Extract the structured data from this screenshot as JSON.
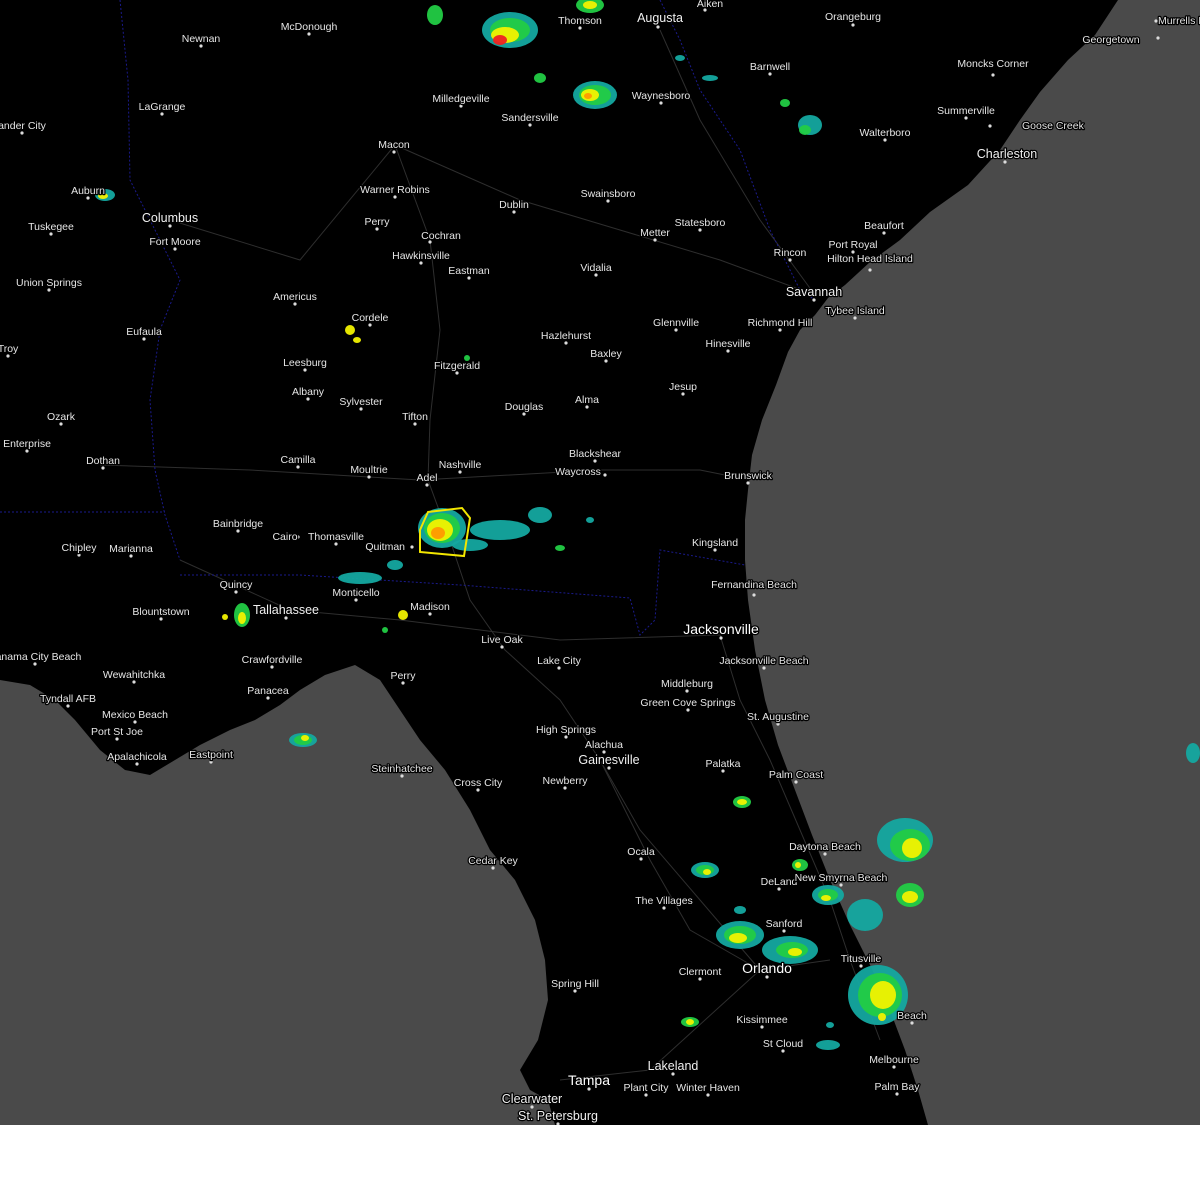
{
  "map": {
    "colors": {
      "land": "#000000",
      "water": "#4a4a4a",
      "state_border": "#1a1a8c",
      "roads": "#3a3a3a",
      "warning_polygon": "#f2e600",
      "radar_light": "#14a8a0",
      "radar_green": "#22cc44",
      "radar_yellow": "#f2f200",
      "radar_orange": "#ff9900",
      "radar_red": "#ee2222"
    },
    "cities": [
      {
        "name": "Murrells Inlet",
        "size": "small"
      },
      {
        "name": "Georgetown",
        "size": "small"
      },
      {
        "name": "Moncks Corner",
        "size": "small"
      },
      {
        "name": "Summerville",
        "size": "small"
      },
      {
        "name": "Goose Creek",
        "size": "small"
      },
      {
        "name": "Charleston",
        "size": "medium"
      },
      {
        "name": "Walterboro",
        "size": "small"
      },
      {
        "name": "Orangeburg",
        "size": "small"
      },
      {
        "name": "Aiken",
        "size": "small"
      },
      {
        "name": "Augusta",
        "size": "medium"
      },
      {
        "name": "Thomson",
        "size": "small"
      },
      {
        "name": "Barnwell",
        "size": "small"
      },
      {
        "name": "Waynesboro",
        "size": "small"
      },
      {
        "name": "McDonough",
        "size": "small"
      },
      {
        "name": "Newnan",
        "size": "small"
      },
      {
        "name": "LaGrange",
        "size": "small"
      },
      {
        "name": "Milledgeville",
        "size": "small"
      },
      {
        "name": "Sandersville",
        "size": "small"
      },
      {
        "name": "Macon",
        "size": "small"
      },
      {
        "name": "Warner Robins",
        "size": "small"
      },
      {
        "name": "Dublin",
        "size": "small"
      },
      {
        "name": "Swainsboro",
        "size": "small"
      },
      {
        "name": "Perry",
        "size": "small"
      },
      {
        "name": "Cochran",
        "size": "small"
      },
      {
        "name": "Hawkinsville",
        "size": "small"
      },
      {
        "name": "Eastman",
        "size": "small"
      },
      {
        "name": "Metter",
        "size": "small"
      },
      {
        "name": "Statesboro",
        "size": "small"
      },
      {
        "name": "Vidalia",
        "size": "small"
      },
      {
        "name": "Rincon",
        "size": "small"
      },
      {
        "name": "Beaufort",
        "size": "small"
      },
      {
        "name": "Port Royal",
        "size": "small"
      },
      {
        "name": "Hilton Head Island",
        "size": "small"
      },
      {
        "name": "Savannah",
        "size": "medium"
      },
      {
        "name": "Tybee Island",
        "size": "small"
      },
      {
        "name": "Richmond Hill",
        "size": "small"
      },
      {
        "name": "Glennville",
        "size": "small"
      },
      {
        "name": "Hinesville",
        "size": "small"
      },
      {
        "name": "Hazlehurst",
        "size": "small"
      },
      {
        "name": "Baxley",
        "size": "small"
      },
      {
        "name": "Jesup",
        "size": "small"
      },
      {
        "name": "Alma",
        "size": "small"
      },
      {
        "name": "Douglas",
        "size": "small"
      },
      {
        "name": "Fitzgerald",
        "size": "small"
      },
      {
        "name": "Cordele",
        "size": "small"
      },
      {
        "name": "Americus",
        "size": "small"
      },
      {
        "name": "Leesburg",
        "size": "small"
      },
      {
        "name": "Albany",
        "size": "small"
      },
      {
        "name": "Sylvester",
        "size": "small"
      },
      {
        "name": "Tifton",
        "size": "small"
      },
      {
        "name": "Blackshear",
        "size": "small"
      },
      {
        "name": "Waycross",
        "size": "small"
      },
      {
        "name": "Nashville",
        "size": "small"
      },
      {
        "name": "Adel",
        "size": "small"
      },
      {
        "name": "Moultrie",
        "size": "small"
      },
      {
        "name": "Camilla",
        "size": "small"
      },
      {
        "name": "Brunswick",
        "size": "small"
      },
      {
        "name": "Kingsland",
        "size": "small"
      },
      {
        "name": "Fernandina Beach",
        "size": "small"
      },
      {
        "name": "Auburn",
        "size": "small"
      },
      {
        "name": "Columbus",
        "size": "medium"
      },
      {
        "name": "Fort Moore",
        "size": "small"
      },
      {
        "name": "Tuskegee",
        "size": "small"
      },
      {
        "name": "ander City",
        "size": "small"
      },
      {
        "name": "Union Springs",
        "size": "small"
      },
      {
        "name": "Eufaula",
        "size": "small"
      },
      {
        "name": "Troy",
        "size": "small"
      },
      {
        "name": "Ozark",
        "size": "small"
      },
      {
        "name": "Enterprise",
        "size": "small"
      },
      {
        "name": "Dothan",
        "size": "small"
      },
      {
        "name": "Bainbridge",
        "size": "small"
      },
      {
        "name": "Cairo",
        "size": "small"
      },
      {
        "name": "Thomasville",
        "size": "small"
      },
      {
        "name": "Quitman",
        "size": "small"
      },
      {
        "name": "Chipley",
        "size": "small"
      },
      {
        "name": "Marianna",
        "size": "small"
      },
      {
        "name": "Quincy",
        "size": "small"
      },
      {
        "name": "Tallahassee",
        "size": "medium"
      },
      {
        "name": "Blountstown",
        "size": "small"
      },
      {
        "name": "Monticello",
        "size": "small"
      },
      {
        "name": "Madison",
        "size": "small"
      },
      {
        "name": "Live Oak",
        "size": "small"
      },
      {
        "name": "Lake City",
        "size": "small"
      },
      {
        "name": "Jacksonville",
        "size": "large"
      },
      {
        "name": "Jacksonville Beach",
        "size": "small"
      },
      {
        "name": "Panama City Beach",
        "size": "small"
      },
      {
        "name": "Wewahitchka",
        "size": "small"
      },
      {
        "name": "Crawfordville",
        "size": "small"
      },
      {
        "name": "Perry",
        "size": "small"
      },
      {
        "name": "Tyndall AFB",
        "size": "small"
      },
      {
        "name": "Panacea",
        "size": "small"
      },
      {
        "name": "Mexico Beach",
        "size": "small"
      },
      {
        "name": "Port St Joe",
        "size": "small"
      },
      {
        "name": "Apalachicola",
        "size": "small"
      },
      {
        "name": "Eastpoint",
        "size": "small"
      },
      {
        "name": "Middleburg",
        "size": "small"
      },
      {
        "name": "Green Cove Springs",
        "size": "small"
      },
      {
        "name": "St. Augustine",
        "size": "small"
      },
      {
        "name": "High Springs",
        "size": "small"
      },
      {
        "name": "Alachua",
        "size": "small"
      },
      {
        "name": "Gainesville",
        "size": "medium"
      },
      {
        "name": "Palatka",
        "size": "small"
      },
      {
        "name": "Palm Coast",
        "size": "small"
      },
      {
        "name": "Steinhatchee",
        "size": "small"
      },
      {
        "name": "Cross City",
        "size": "small"
      },
      {
        "name": "Newberry",
        "size": "small"
      },
      {
        "name": "Ocala",
        "size": "small"
      },
      {
        "name": "Daytona Beach",
        "size": "small"
      },
      {
        "name": "DeLand",
        "size": "small"
      },
      {
        "name": "New Smyrna Beach",
        "size": "small"
      },
      {
        "name": "Cedar Key",
        "size": "small"
      },
      {
        "name": "The Villages",
        "size": "small"
      },
      {
        "name": "Sanford",
        "size": "small"
      },
      {
        "name": "Clermont",
        "size": "small"
      },
      {
        "name": "Orlando",
        "size": "large"
      },
      {
        "name": "Titusville",
        "size": "small"
      },
      {
        "name": "Spring Hill",
        "size": "small"
      },
      {
        "name": "Kissimmee",
        "size": "small"
      },
      {
        "name": "St Cloud",
        "size": "small"
      },
      {
        "name": "Beach",
        "size": "small"
      },
      {
        "name": "Melbourne",
        "size": "small"
      },
      {
        "name": "Palm Bay",
        "size": "small"
      },
      {
        "name": "Lakeland",
        "size": "medium"
      },
      {
        "name": "Tampa",
        "size": "large"
      },
      {
        "name": "Plant City",
        "size": "small"
      },
      {
        "name": "Winter Haven",
        "size": "small"
      },
      {
        "name": "Clearwater",
        "size": "medium"
      },
      {
        "name": "St. Petersburg",
        "size": "medium"
      }
    ]
  }
}
